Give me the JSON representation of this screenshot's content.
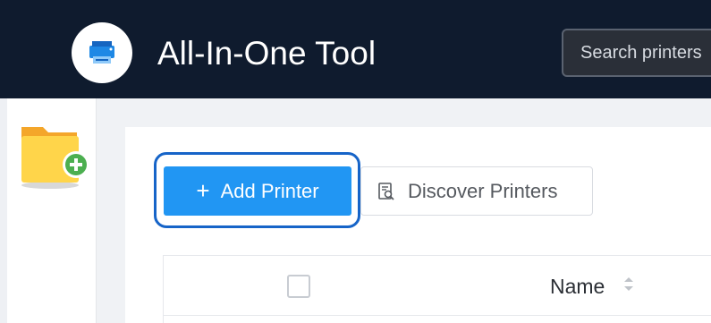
{
  "header": {
    "app_title": "All-In-One Tool",
    "search_placeholder": "Search printers",
    "background": "#0f1b2e"
  },
  "sidebar": {
    "items": [
      {
        "icon": "add-folder-icon"
      }
    ]
  },
  "toolbar": {
    "add_label": "Add Printer",
    "add_icon": "plus-icon",
    "discover_label": "Discover Printers",
    "discover_icon": "discover-icon",
    "accent": "#2196f3",
    "focus_color": "#1664c8"
  },
  "table": {
    "columns": [
      {
        "label": ""
      },
      {
        "label": "Name",
        "sortable": true
      }
    ]
  }
}
